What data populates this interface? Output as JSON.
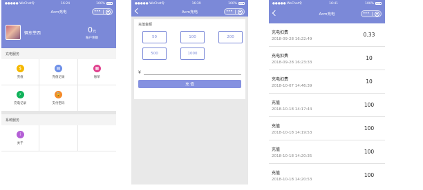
{
  "colors": {
    "accent": "#7b89d8",
    "button": "#8591e0",
    "icon_yellow": "#f5b800",
    "icon_blue": "#6d8fe8",
    "icon_pink": "#e0418e",
    "icon_green": "#10b25a",
    "icon_orange": "#f58a2a",
    "icon_purple": "#b45fd6"
  },
  "status_bar": {
    "carrier": "●●●●● WeChat令",
    "batt_pct": "100%"
  },
  "screen_home": {
    "time": "16:24",
    "title": "Acm充电",
    "user": {
      "name": "辆东莘西"
    },
    "balance": {
      "value": "0",
      "unit": "元",
      "label": "账户余额"
    },
    "service_section": "充电服务",
    "service_items": [
      {
        "label": "充值",
        "icon": "moneybag-icon",
        "color": "#f5b800",
        "glyph": "$"
      },
      {
        "label": "充值记录",
        "icon": "record-icon",
        "color": "#6d8fe8",
        "glyph": "▤"
      },
      {
        "label": "账单",
        "icon": "bill-icon",
        "color": "#e0418e",
        "glyph": "▦"
      },
      {
        "label": "充电记录",
        "icon": "charge-icon",
        "color": "#10b25a",
        "glyph": "⚡"
      },
      {
        "label": "支付密码",
        "icon": "lock-icon",
        "color": "#f58a2a",
        "glyph": "🔒"
      }
    ],
    "system_section": "系统服务",
    "system_items": [
      {
        "label": "关于",
        "icon": "info-icon",
        "color": "#b45fd6",
        "glyph": "i"
      }
    ]
  },
  "screen_recharge": {
    "time": "16:39",
    "title": "Acm充电",
    "amount_title": "充值金额",
    "amounts": [
      "50",
      "100",
      "200",
      "500",
      "1000"
    ],
    "currency": "¥",
    "submit_label": "充 值"
  },
  "screen_records": {
    "time": "16:41",
    "title": "Acm充电",
    "records": [
      {
        "title": "充电扣费",
        "time": "2018-09-28 16:22:49",
        "value": "0.33"
      },
      {
        "title": "充电扣费",
        "time": "2018-09-28 16:23:33",
        "value": "10"
      },
      {
        "title": "充电扣费",
        "time": "2018-10-07 14:46:39",
        "value": "10"
      },
      {
        "title": "充值",
        "time": "2018-10-18 14:17:44",
        "value": "100"
      },
      {
        "title": "充值",
        "time": "2018-10-18 14:19:53",
        "value": "100"
      },
      {
        "title": "充值",
        "time": "2018-10-18 14:20:35",
        "value": "100"
      },
      {
        "title": "充值",
        "time": "2018-10-18 14:20:53",
        "value": "100"
      }
    ]
  }
}
